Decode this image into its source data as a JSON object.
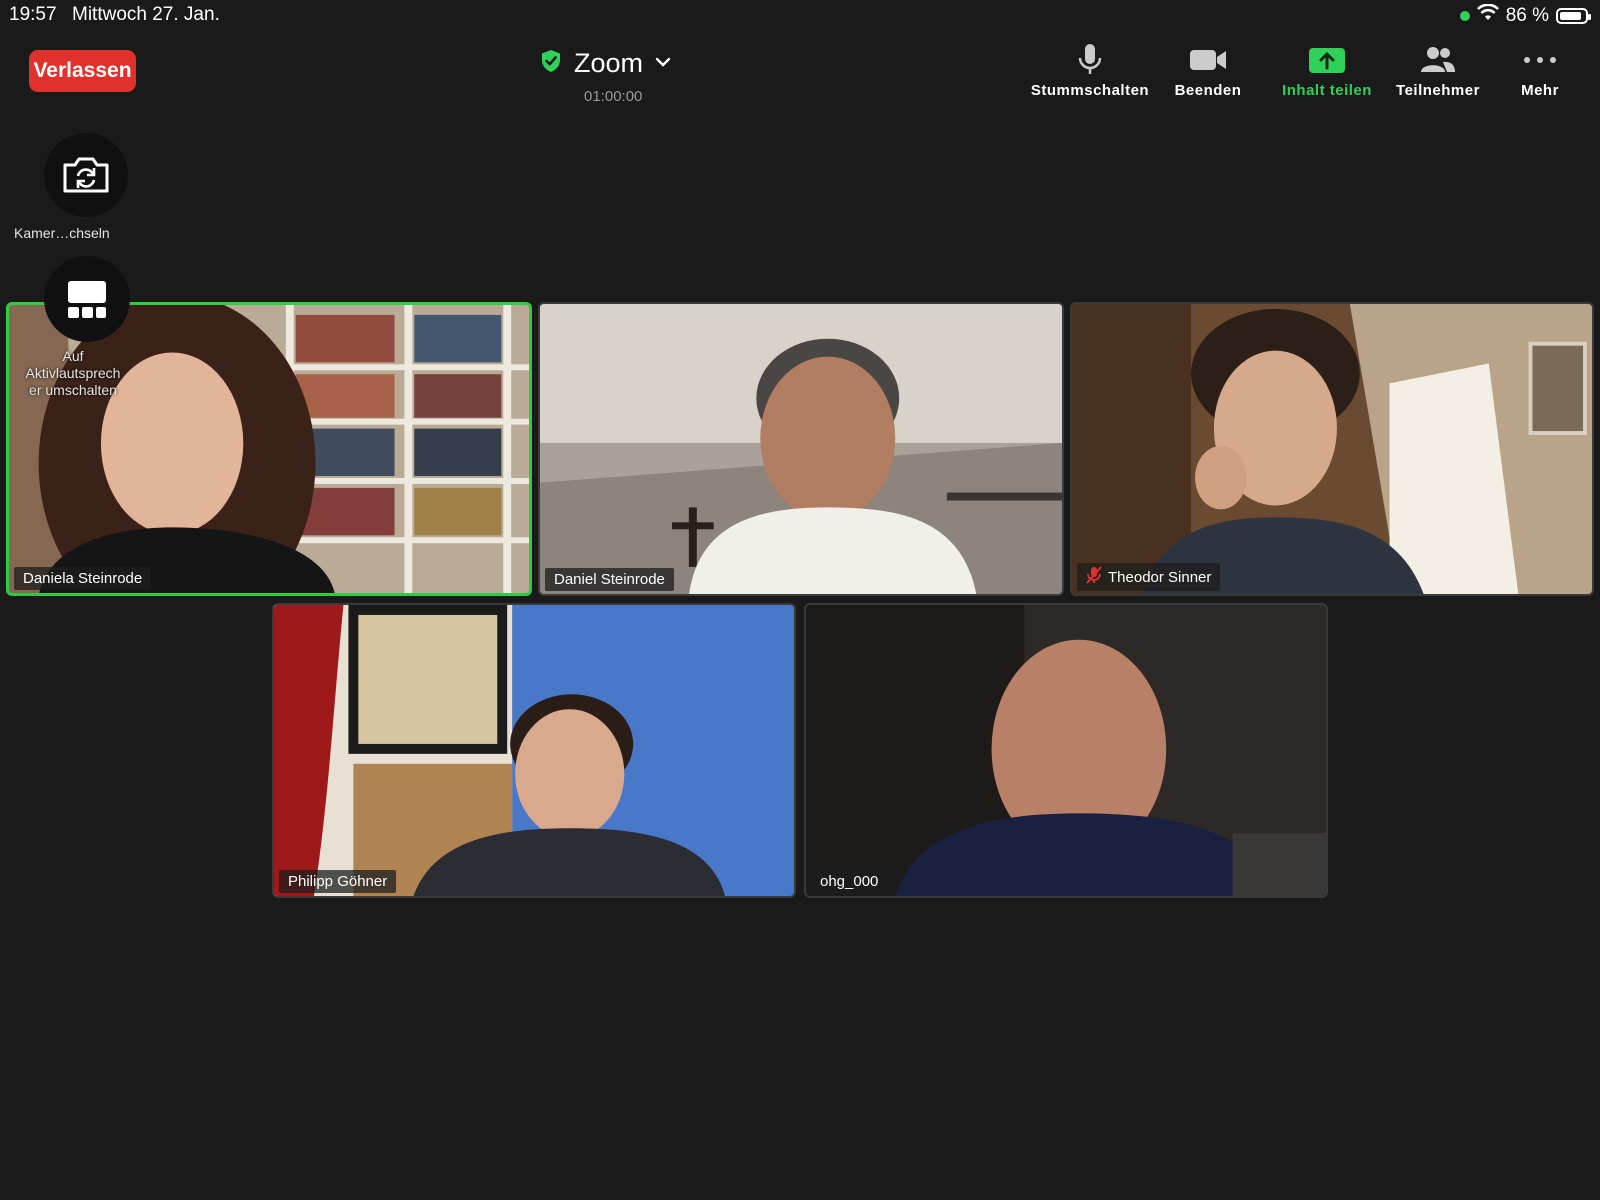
{
  "status": {
    "time": "19:57",
    "date": "Mittwoch 27. Jan.",
    "battery": "86 %",
    "battery_level": 0.86
  },
  "leave_button": "Verlassen",
  "meeting": {
    "title": "Zoom",
    "timer": "01:00:00"
  },
  "toolbar": [
    {
      "label": "Stummschalten",
      "icon": "microphone-icon"
    },
    {
      "label": "Beenden",
      "icon": "video-camera-icon"
    },
    {
      "label": "Inhalt teilen",
      "icon": "share-arrow-icon",
      "color": "#30d158"
    },
    {
      "label": "Teilnehmer",
      "icon": "participants-icon"
    },
    {
      "label": "Mehr",
      "icon": "more-dots-icon"
    }
  ],
  "side_controls": {
    "switch_camera": "Kamer…chseln",
    "speaker_view_lines": [
      "Auf",
      "Aktivlautsprech",
      "er umschalten"
    ]
  },
  "participants": [
    {
      "name": "Daniela Steinrode",
      "active_speaker": true,
      "muted": false
    },
    {
      "name": "Daniel Steinrode",
      "active_speaker": false,
      "muted": false
    },
    {
      "name": "Theodor Sinner",
      "active_speaker": false,
      "muted": true
    },
    {
      "name": "Philipp Göhner",
      "active_speaker": false,
      "muted": false
    },
    {
      "name": "ohg_000",
      "active_speaker": false,
      "muted": false
    }
  ],
  "colors": {
    "leave": "#e0312c",
    "active_speaker_border": "#2ecc40",
    "share_green": "#30d158"
  }
}
